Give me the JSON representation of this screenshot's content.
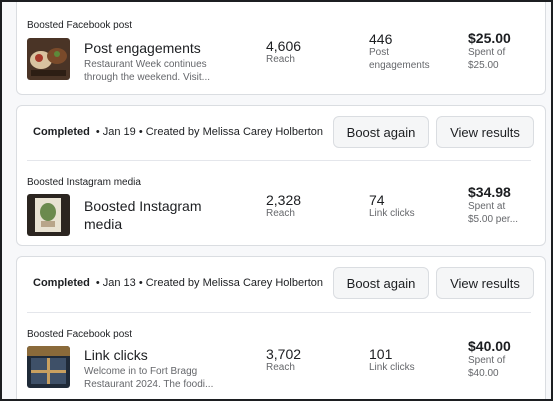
{
  "rows": [
    {
      "type_label": "Boosted Facebook post",
      "thumb_icon": "food-photo-thumbnail",
      "title": "Post engagements",
      "desc_line1": "Restaurant Week continues",
      "desc_line2": "through the weekend. Visit...",
      "reach_value": "4,606",
      "reach_label": "Reach",
      "metric_value": "446",
      "metric_label_line1": "Post",
      "metric_label_line2": "engagements",
      "cost_value": "$25.00",
      "cost_label_line1": "Spent of",
      "cost_label_line2": "$25.00"
    },
    {
      "status": "Completed",
      "meta": "• Jan 19 • Created by Melissa Carey Holberton",
      "boost_again": "Boost again",
      "view_results": "View results",
      "type_label": "Boosted Instagram media",
      "thumb_icon": "instagram-photo-thumbnail",
      "title_line1": "Boosted Instagram",
      "title_line2": "media",
      "reach_value": "2,328",
      "reach_label": "Reach",
      "metric_value": "74",
      "metric_label_line1": "Link clicks",
      "cost_value": "$34.98",
      "cost_label_line1": "Spent at",
      "cost_label_line2": "$5.00 per..."
    },
    {
      "status": "Completed",
      "meta": "• Jan 13 • Created by Melissa Carey Holberton",
      "boost_again": "Boost again",
      "view_results": "View results",
      "type_label": "Boosted Facebook post",
      "thumb_icon": "restaurant-photo-thumbnail",
      "title": "Link clicks",
      "desc_line1": "Welcome in to Fort Bragg",
      "desc_line2": "Restaurant 2024. The foodi...",
      "reach_value": "3,702",
      "reach_label": "Reach",
      "metric_value": "101",
      "metric_label_line1": "Link clicks",
      "cost_value": "$40.00",
      "cost_label_line1": "Spent of",
      "cost_label_line2": "$40.00"
    }
  ]
}
